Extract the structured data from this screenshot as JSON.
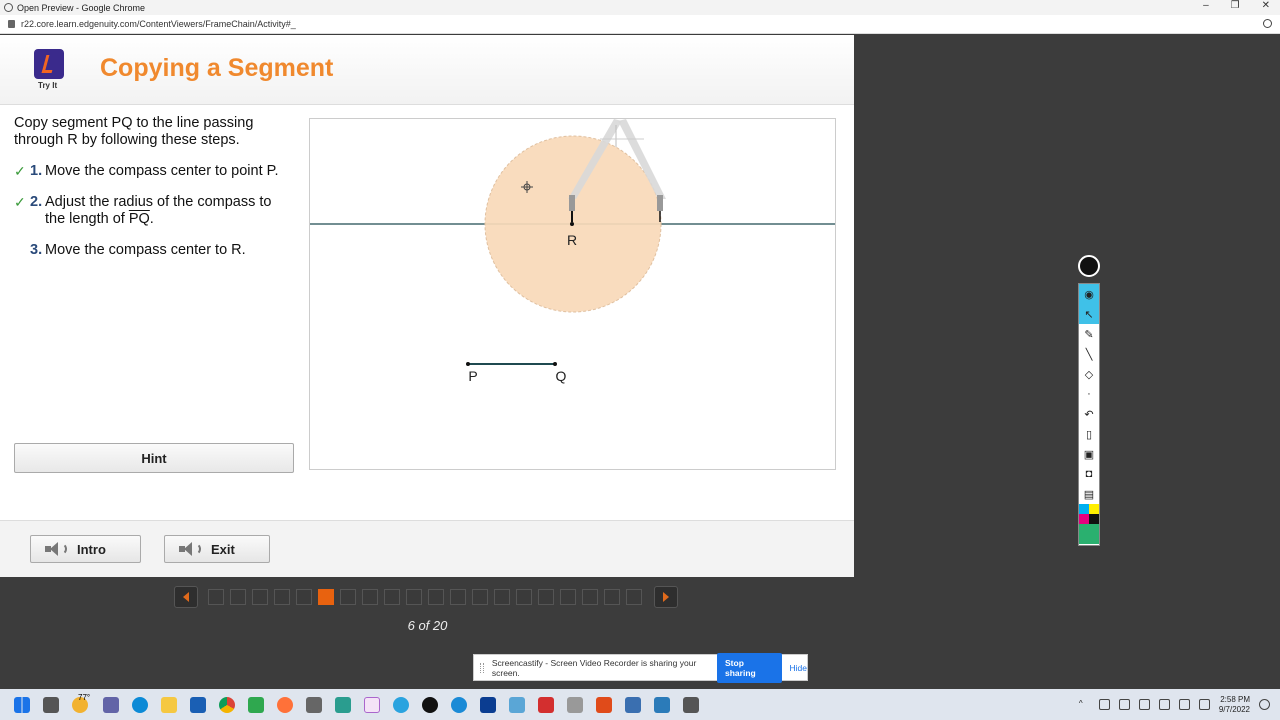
{
  "browser": {
    "window_title": "Open Preview - Google Chrome",
    "url": "r22.core.learn.edgenuity.com/ContentViewers/FrameChain/Activity#_",
    "controls": [
      "–",
      "❐",
      "✕"
    ]
  },
  "lesson": {
    "logo_label": "Try It",
    "title": "Copying a Segment",
    "intro_text": "Copy segment PQ to the line passing through R by following these steps.",
    "steps": [
      {
        "check": "✓",
        "number": "1.",
        "text": "Move the compass center to point P."
      },
      {
        "check": "✓",
        "number": "2.",
        "text_before": "Adjust the radius of the compass to the length of ",
        "overline_text": "PQ",
        "text_after": "."
      },
      {
        "check": "",
        "number": "3.",
        "text": "Move the compass center to R."
      }
    ],
    "hint_label": "Hint",
    "diagram": {
      "point_R": "R",
      "point_P": "P",
      "point_Q": "Q"
    },
    "footer": {
      "intro_label": "Intro",
      "exit_label": "Exit"
    }
  },
  "pager": {
    "total": 20,
    "current": 6,
    "label": "6 of 20"
  },
  "screencastify": {
    "message": "Screencastify - Screen Video Recorder is sharing your screen.",
    "stop_label": "Stop sharing",
    "hide_label": "Hide"
  },
  "annotation_toolbar": {
    "tools": [
      "eye-icon",
      "pointer-icon",
      "highlighter-icon",
      "pen-icon",
      "eraser-icon",
      "dot-icon",
      "undo-icon",
      "trash-icon",
      "whiteboard-icon",
      "camera-icon",
      "clipboard-icon"
    ],
    "swatches": [
      "#00b0f0",
      "#ffee00",
      "#e6007e",
      "#111111",
      "#2ab06f"
    ]
  },
  "taskbar": {
    "weather": "77°",
    "time": "2:58 PM",
    "date": "9/7/2022"
  },
  "colors": {
    "title_orange": "#f0892e",
    "compass_fill": "#f9d9b8",
    "line_color": "#1f4a50",
    "active_page": "#e8620f"
  }
}
